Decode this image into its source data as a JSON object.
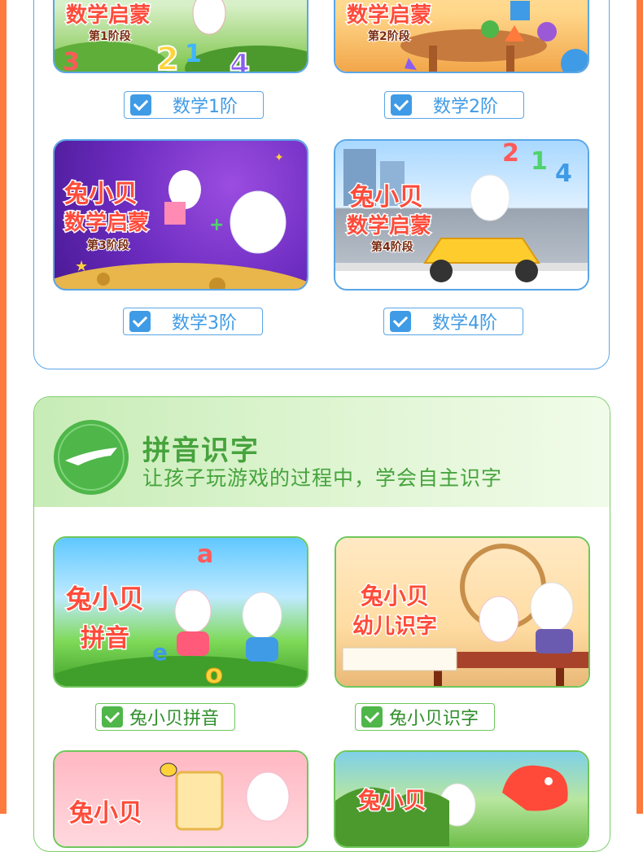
{
  "math_section": {
    "cards": [
      {
        "title": "数学启蒙",
        "stage": "第1阶段",
        "checkbox_label": "数学1阶",
        "checked": true
      },
      {
        "title": "数学启蒙",
        "stage": "第2阶段",
        "checkbox_label": "数学2阶",
        "checked": true
      },
      {
        "title": "兔小贝",
        "subtitle": "数学启蒙",
        "stage": "第3阶段",
        "checkbox_label": "数学3阶",
        "checked": true
      },
      {
        "title": "兔小贝",
        "subtitle": "数学启蒙",
        "stage": "第4阶段",
        "checkbox_label": "数学4阶",
        "checked": true
      }
    ]
  },
  "pinyin_section": {
    "title": "拼音识字",
    "subtitle": "让孩子玩游戏的过程中，学会自主识字",
    "cards": [
      {
        "title": "兔小贝",
        "subtitle": "拼音",
        "checkbox_label": "兔小贝拼音",
        "checked": true
      },
      {
        "title": "兔小贝",
        "subtitle": "幼儿识字",
        "checkbox_label": "兔小贝识字",
        "checked": true
      },
      {
        "title": "兔小贝"
      },
      {
        "title": "兔小贝"
      }
    ]
  },
  "colors": {
    "accent_orange": "#ff7a3d",
    "math_blue": "#3f9be6",
    "pinyin_green": "#4fb64a"
  }
}
